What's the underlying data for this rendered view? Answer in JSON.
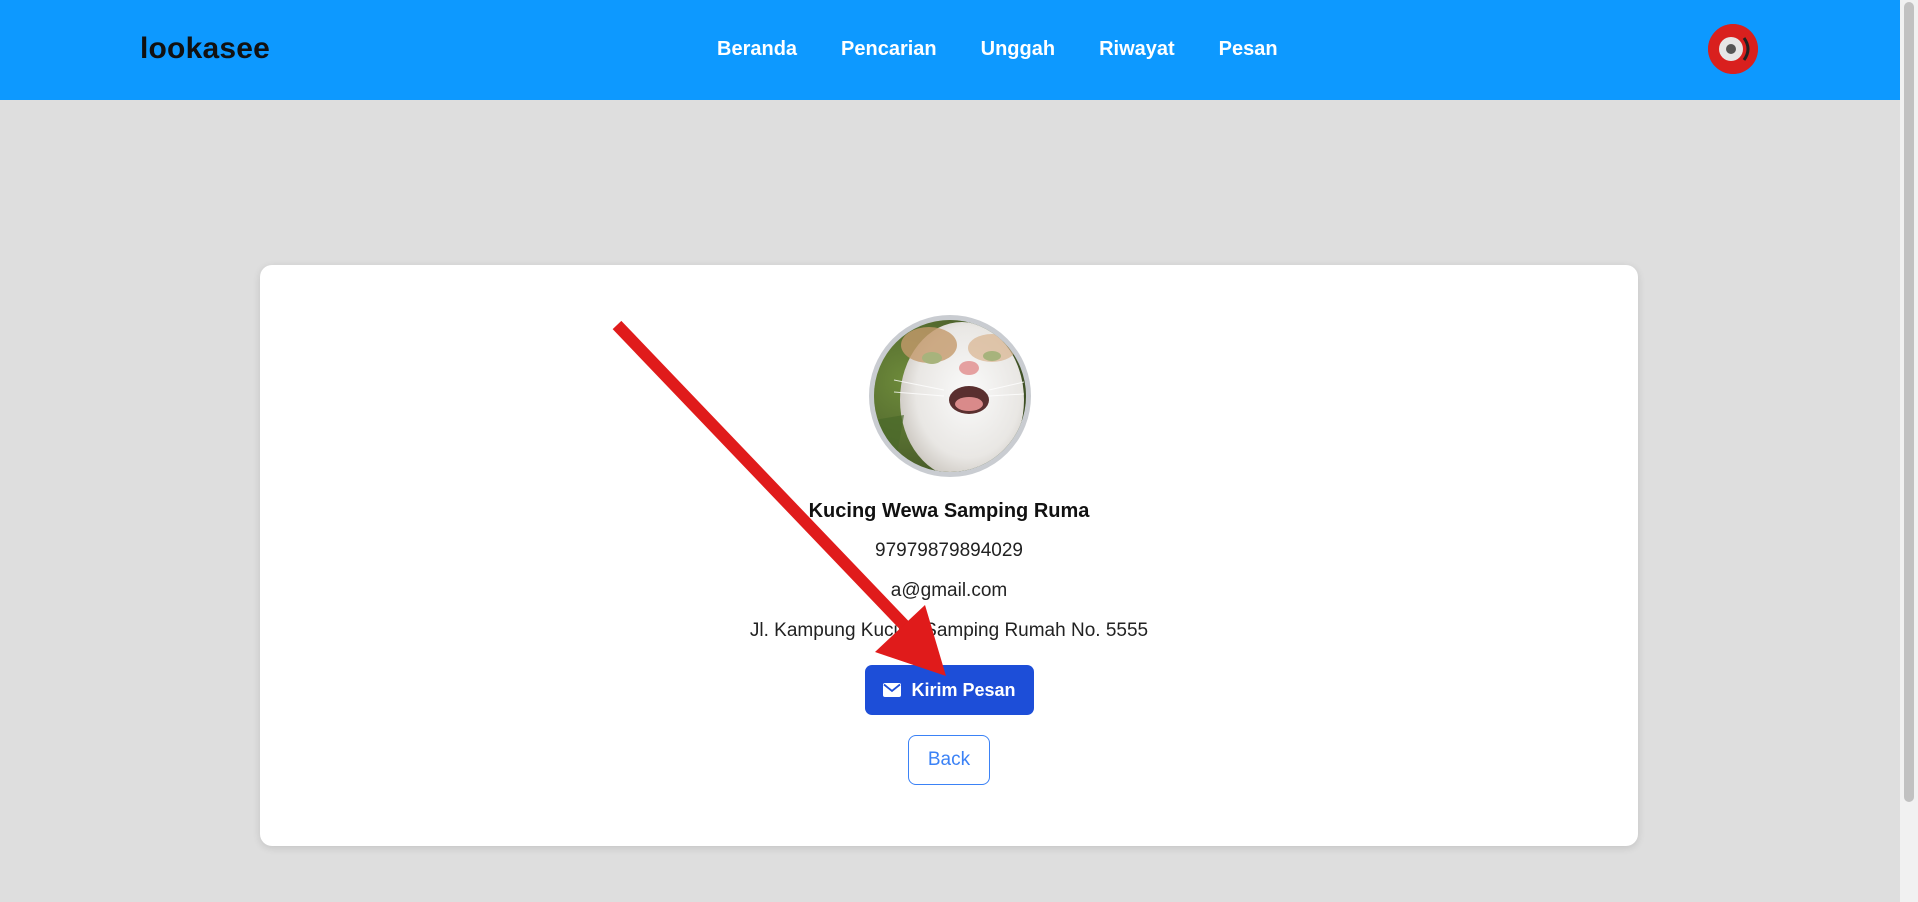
{
  "navbar": {
    "brand": "lookasee",
    "links": [
      {
        "label": "Beranda"
      },
      {
        "label": "Pencarian"
      },
      {
        "label": "Unggah"
      },
      {
        "label": "Riwayat"
      },
      {
        "label": "Pesan"
      }
    ],
    "background_color": "#0d99ff",
    "avatar_icon": "user-avatar-icon"
  },
  "profile": {
    "name": "Kucing Wewa Samping Ruma",
    "phone": "97979879894029",
    "email": "a@gmail.com",
    "address": "Jl. Kampung Kucing Samping Rumah No. 5555"
  },
  "actions": {
    "send_message_label": "Kirim Pesan",
    "send_message_icon": "mail-icon",
    "back_label": "Back"
  },
  "colors": {
    "primary_button": "#1d4ed8",
    "outline_button": "#3b82f6",
    "annotation_arrow": "#e01b1b"
  }
}
